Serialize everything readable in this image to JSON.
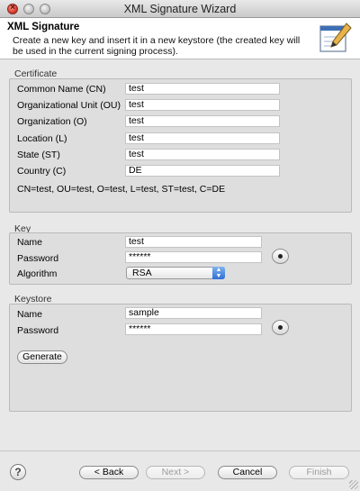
{
  "window": {
    "title": "XML Signature Wizard"
  },
  "banner": {
    "title": "XML Signature",
    "description": "Create a new key and insert it in a new keystore (the created key will be used in the current signing process)."
  },
  "certificate": {
    "group_label": "Certificate",
    "fields": [
      {
        "label": "Common Name (CN)",
        "value": "test"
      },
      {
        "label": "Organizational Unit (OU)",
        "value": "test"
      },
      {
        "label": "Organization (O)",
        "value": "test"
      },
      {
        "label": "Location (L)",
        "value": "test"
      },
      {
        "label": "State (ST)",
        "value": "test"
      },
      {
        "label": "Country (C)",
        "value": "DE"
      }
    ],
    "summary": "CN=test, OU=test, O=test, L=test, ST=test, C=DE"
  },
  "key": {
    "group_label": "Key",
    "name_label": "Name",
    "name_value": "test",
    "password_label": "Password",
    "password_value": "******",
    "algorithm_label": "Algorithm",
    "algorithm_value": "RSA"
  },
  "keystore": {
    "group_label": "Keystore",
    "name_label": "Name",
    "name_value": "sample",
    "password_label": "Password",
    "password_value": "******",
    "generate_label": "Generate"
  },
  "footer": {
    "help_glyph": "?",
    "back_label": "< Back",
    "next_label": "Next >",
    "cancel_label": "Cancel",
    "finish_label": "Finish"
  },
  "colors": {
    "accent_select": "#2f6fd6",
    "close_button": "#d83a2c"
  }
}
